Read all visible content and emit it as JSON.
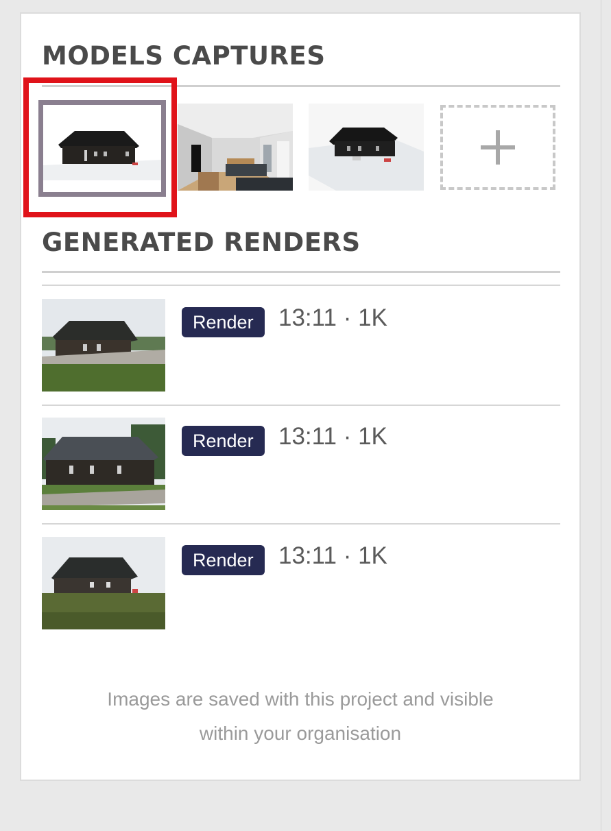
{
  "models_captures": {
    "title": "MODELS CAPTURES",
    "items": [
      {
        "name": "exterior-front-capture",
        "selected": true
      },
      {
        "name": "interior-living-capture",
        "selected": false
      },
      {
        "name": "exterior-angle-capture",
        "selected": false
      }
    ],
    "add_icon": "plus-icon"
  },
  "generated_renders": {
    "title": "GENERATED RENDERS",
    "items": [
      {
        "badge": "Render",
        "meta": "13:11 · 1K"
      },
      {
        "badge": "Render",
        "meta": "13:11 · 1K"
      },
      {
        "badge": "Render",
        "meta": "13:11 · 1K"
      }
    ]
  },
  "footer": {
    "line1": "Images are saved with this project and visible",
    "line2": "within your organisation"
  },
  "colors": {
    "badge_bg": "#262a52",
    "selection_outline": "#e0131a",
    "selected_frame": "#8a7f8f"
  }
}
